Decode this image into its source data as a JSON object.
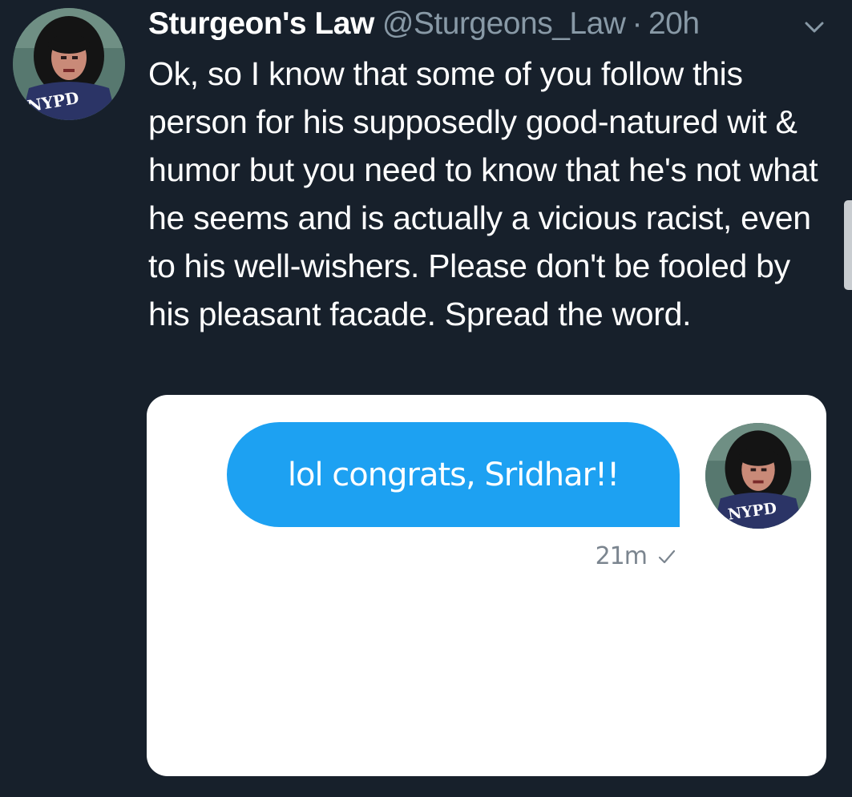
{
  "tweet": {
    "display_name": "Sturgeon's Law",
    "handle": "@Sturgeons_Law",
    "separator": "·",
    "time": "20h",
    "text": "Ok, so I know that some of you follow this person for his supposedly good-natured wit & humor but you need to know that he's not what he seems and is actually a vicious racist, even to his well-wishers. Please don't be fooled by his pleasant facade. Spread the word.",
    "avatar_shirt_text": "NYPD",
    "menu_icon": "chevron-down-icon"
  },
  "media": {
    "message_text": "lol congrats, Sridhar!!",
    "message_time": "21m",
    "status_icon": "check-icon",
    "avatar_shirt_text": "NYPD"
  },
  "colors": {
    "background": "#17202b",
    "text_primary": "#ffffff",
    "text_secondary": "#8899a6",
    "bubble": "#1da1f2",
    "card": "#ffffff"
  }
}
